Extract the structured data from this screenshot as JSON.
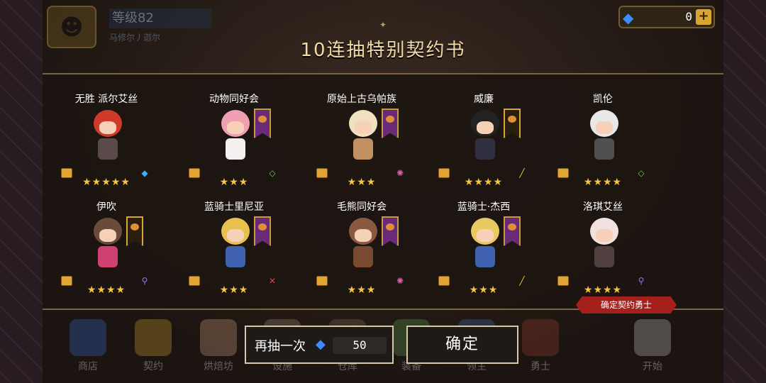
{
  "header": {
    "level": "等级82",
    "player_name": "马修尔丿迦尔",
    "gems": "0",
    "add_label": "+"
  },
  "dialog": {
    "title": "10连抽特别契约书",
    "heroes": [
      {
        "name": "无胜 派尔艾丝",
        "stars": "★★★★★",
        "banner": "none",
        "class_icon": "shield-icon",
        "head_color": "#8a8a8a",
        "hair_color": "#d03a2a",
        "body_color": "#5a4a4a"
      },
      {
        "name": "动物同好会",
        "stars": "★★★",
        "banner": "purple",
        "class_icon": "diamond-icon",
        "head_color": "#f5e8ea",
        "hair_color": "#f0a0b0",
        "body_color": "#f5f0f0"
      },
      {
        "name": "原始上古乌帕族",
        "stars": "★★★",
        "banner": "purple",
        "class_icon": "magic-icon",
        "head_color": "#c93a2a",
        "hair_color": "#f0e0c0",
        "body_color": "#c09060"
      },
      {
        "name": "威廉",
        "stars": "★★★★",
        "banner": "gold",
        "class_icon": "staff-icon",
        "head_color": "#222222",
        "hair_color": "#222222",
        "body_color": "#303040"
      },
      {
        "name": "凯伦",
        "stars": "★★★★",
        "banner": "none",
        "class_icon": "diamond-icon",
        "head_color": "#f0f0f0",
        "hair_color": "#e8e8e8",
        "body_color": "#505050"
      },
      {
        "name": "伊吹",
        "stars": "★★★★",
        "banner": "gold",
        "class_icon": "wand-icon",
        "head_color": "#6a4a3a",
        "hair_color": "#6a4a3a",
        "body_color": "#d04070"
      },
      {
        "name": "蓝骑士里尼亚",
        "stars": "★★★",
        "banner": "purple",
        "class_icon": "sword-icon",
        "head_color": "#e8c050",
        "hair_color": "#e8c050",
        "body_color": "#4060b0"
      },
      {
        "name": "毛熊同好会",
        "stars": "★★★",
        "banner": "purple",
        "class_icon": "magic-icon",
        "head_color": "#8a5a40",
        "hair_color": "#8a5a40",
        "body_color": "#7a4a30"
      },
      {
        "name": "蓝骑士·杰西",
        "stars": "★★★",
        "banner": "purple",
        "class_icon": "staff-icon",
        "head_color": "#e8c860",
        "hair_color": "#e8c860",
        "body_color": "#4060b0"
      },
      {
        "name": "洛琪艾丝",
        "stars": "★★★★",
        "banner": "none",
        "class_icon": "wand-icon",
        "head_color": "#f0e0e0",
        "hair_color": "#f0e0e0",
        "body_color": "#504040"
      }
    ],
    "confirm_tag": "确定契约勇士"
  },
  "buttons": {
    "redraw_label": "再抽一次",
    "redraw_cost": "50",
    "confirm_label": "确定"
  },
  "nav": [
    {
      "label": "商店",
      "color": "#3a6ad0"
    },
    {
      "label": "契约",
      "color": "#d0a030"
    },
    {
      "label": "烘焙坊",
      "color": "#d0a080"
    },
    {
      "label": "设施",
      "color": "#9a8a70"
    },
    {
      "label": "仓库",
      "color": "#7a6a50"
    },
    {
      "label": "装备",
      "color": "#5a9a50"
    },
    {
      "label": "领主",
      "color": "#4a6aa0"
    },
    {
      "label": "勇士",
      "color": "#9a4030"
    },
    {
      "label": "开始",
      "color": "#c0c0c0"
    }
  ]
}
